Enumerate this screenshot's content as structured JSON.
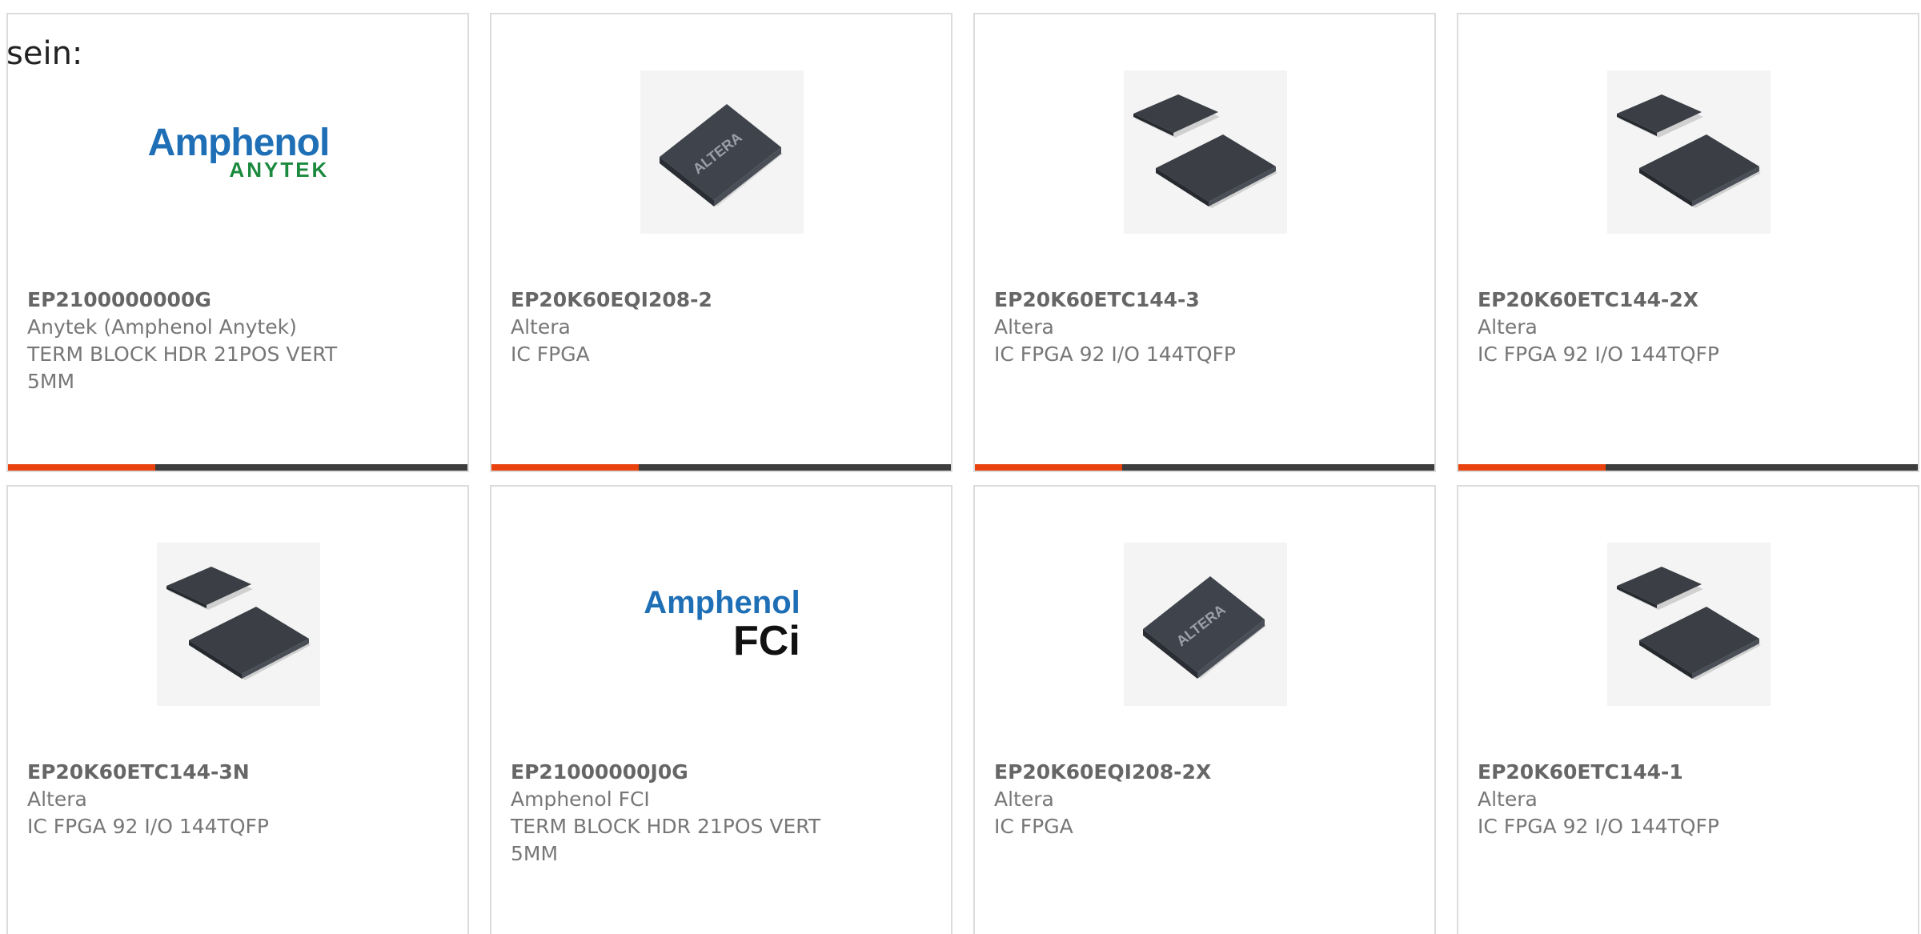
{
  "heading": "sein:",
  "colors": {
    "progress_fill": "#e8430f",
    "progress_track": "#3d3d3d",
    "logo_blue": "#1e6fb6",
    "logo_green": "#1b8a3e"
  },
  "cards": [
    {
      "part": "EP2100000000G",
      "manufacturer": "Anytek (Amphenol Anytek)",
      "description": "TERM BLOCK HDR 21POS VERT 5MM",
      "image": "amphenol-anytek-logo",
      "logo_line1": "Amphenol",
      "logo_line2": "ANYTEK",
      "progress": 0.32
    },
    {
      "part": "EP20K60EQI208-2",
      "manufacturer": "Altera",
      "description": "IC FPGA",
      "image": "altera-chip-photo",
      "progress": 0.32
    },
    {
      "part": "EP20K60ETC144-3",
      "manufacturer": "Altera",
      "description": "IC FPGA 92 I/O 144TQFP",
      "image": "tqfp-chips-photo",
      "progress": 0.32
    },
    {
      "part": "EP20K60ETC144-2X",
      "manufacturer": "Altera",
      "description": "IC FPGA 92 I/O 144TQFP",
      "image": "tqfp-chips-photo",
      "progress": 0.32
    },
    {
      "part": "EP20K60ETC144-3N",
      "manufacturer": "Altera",
      "description": "IC FPGA 92 I/O 144TQFP",
      "image": "tqfp-chips-photo"
    },
    {
      "part": "EP21000000J0G",
      "manufacturer": "Amphenol FCI",
      "description": "TERM BLOCK HDR 21POS VERT 5MM",
      "image": "amphenol-fci-logo",
      "logo_line1": "Amphenol",
      "logo_line2": "FCi"
    },
    {
      "part": "EP20K60EQI208-2X",
      "manufacturer": "Altera",
      "description": "IC FPGA",
      "image": "altera-chip-photo"
    },
    {
      "part": "EP20K60ETC144-1",
      "manufacturer": "Altera",
      "description": "IC FPGA 92 I/O 144TQFP",
      "image": "tqfp-chips-photo"
    }
  ]
}
